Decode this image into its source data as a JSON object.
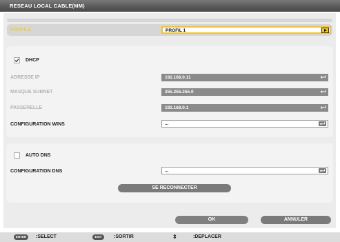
{
  "window": {
    "title": "RESEAU LOCAL CABLE(MM)"
  },
  "profile": {
    "label": "PROFILS",
    "value": "PROFIL 1"
  },
  "network": {
    "dhcp": {
      "label": "DHCP",
      "checked": true
    },
    "ip": {
      "label": "ADRESSE IP",
      "value": "192.168.0.11"
    },
    "subnet": {
      "label": "MASQUE SUBNET",
      "value": "255.255.255.0"
    },
    "gateway": {
      "label": "PASSERELLE",
      "value": "192.168.0.1"
    },
    "wins": {
      "label": "CONFIGURATION WINS",
      "value": "..."
    }
  },
  "dns": {
    "auto": {
      "label": "AUTO DNS",
      "checked": false
    },
    "config": {
      "label": "CONFIGURATION DNS",
      "value": "..."
    }
  },
  "buttons": {
    "reconnect": "SE RECONNECTER",
    "ok": "OK",
    "cancel": "ANNULER"
  },
  "footer": {
    "enter_key": "ENTER",
    "select": ":SELECT",
    "exit_key": "EXIT",
    "exit": ":SORTIR",
    "arrows": "⇕",
    "move": ":DEPLACER"
  },
  "colors": {
    "highlight": "#f0c430",
    "title_bar": "#5a5a5a",
    "field_dark": "#8a8a8a"
  }
}
